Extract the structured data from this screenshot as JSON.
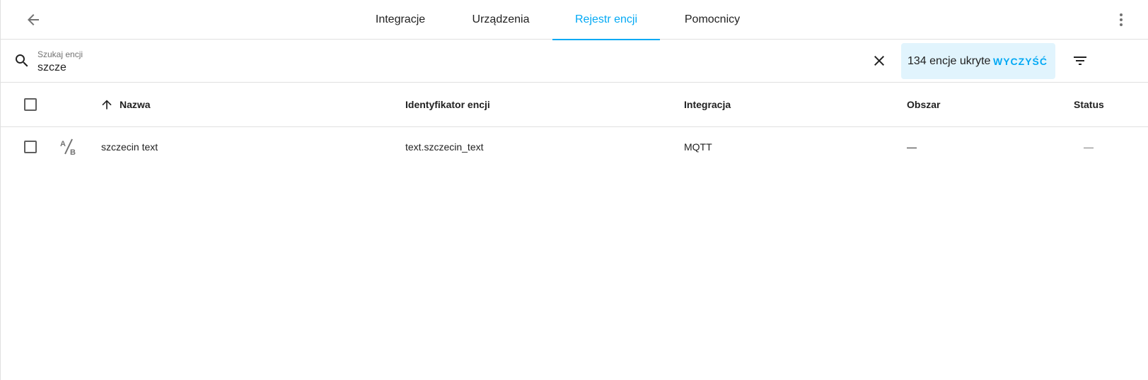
{
  "toolbar": {
    "tabs": [
      {
        "label": "Integracje",
        "active": false
      },
      {
        "label": "Urządzenia",
        "active": false
      },
      {
        "label": "Rejestr encji",
        "active": true
      },
      {
        "label": "Pomocnicy",
        "active": false
      }
    ]
  },
  "search": {
    "label": "Szukaj encji",
    "value": "szcze"
  },
  "filter": {
    "hidden_text": "134 encje ukryte",
    "clear_label": "WYCZYŚĆ"
  },
  "table": {
    "columns": {
      "name": "Nazwa",
      "entity_id": "Identyfikator encji",
      "integration": "Integracja",
      "area": "Obszar",
      "status": "Status"
    },
    "sort": {
      "column": "name",
      "direction": "ascending"
    },
    "rows": [
      {
        "icon": "text-ab-icon",
        "name": "szczecin text",
        "entity_id": "text.szczecin_text",
        "integration": "MQTT",
        "area": "—",
        "status": "—"
      }
    ]
  },
  "colors": {
    "accent": "#03a9f4",
    "chip_background": "#e1f4fd",
    "divider": "#e0e0e0"
  }
}
